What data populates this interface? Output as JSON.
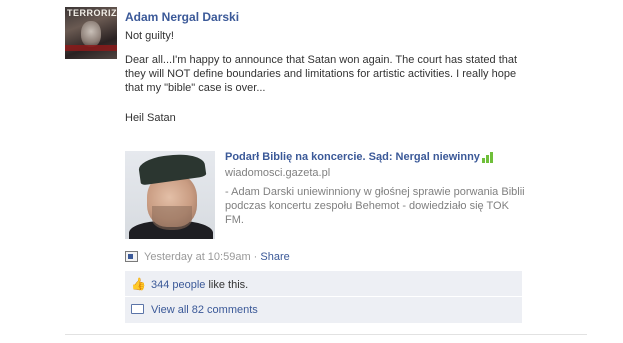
{
  "post": {
    "author": "Adam Nergal Darski",
    "avatar_magazine_text": "TERRORIZER",
    "message": {
      "line1": "Not guilty!",
      "line2": "Dear all...I'm happy to announce that Satan won again. The court has stated that they will NOT define boundaries and limitations for artistic activities. I really hope that my \"bible\" case is over...",
      "line3": "Heil Satan"
    }
  },
  "link": {
    "title": "Podarł Biblię na koncercie. Sąd: Nergal niewinny",
    "domain": "wiadomosci.gazeta.pl",
    "description": "- Adam Darski uniewinniony w głośnej sprawie porwania Biblii podczas koncertu zespołu Behemot - dowiedziało się TOK FM."
  },
  "meta": {
    "timestamp": "Yesterday at 10:59am",
    "separator": " · ",
    "share_label": "Share"
  },
  "likes": {
    "count_link": "344 people",
    "suffix": " like this."
  },
  "comments": {
    "label": "View all 82 comments"
  },
  "icons": {
    "avatar": "profile-picture",
    "thumbnail": "link-thumbnail",
    "app": "mobile-app-icon",
    "like": "thumbs-up-icon",
    "comment": "comment-bubble-icon",
    "signal": "signal-bars-icon"
  },
  "colors": {
    "link_blue": "#3b5998",
    "muted_gray": "#808080",
    "panel_bg": "#edeff4",
    "signal_green": "#6fbf3a"
  }
}
